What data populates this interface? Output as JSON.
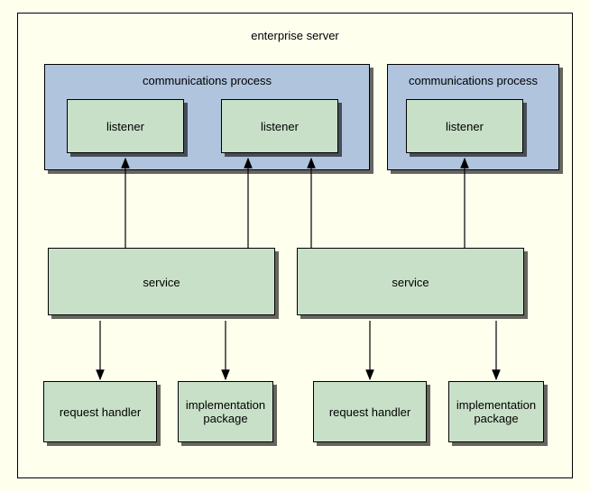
{
  "title": "enterprise server",
  "comm1_label": "communications process",
  "comm2_label": "communications process",
  "listener1": "listener",
  "listener2": "listener",
  "listener3": "listener",
  "service1": "service",
  "service2": "service",
  "rh1": "request handler",
  "impl1": "implementation package",
  "rh2": "request handler",
  "impl2": "implementation package"
}
